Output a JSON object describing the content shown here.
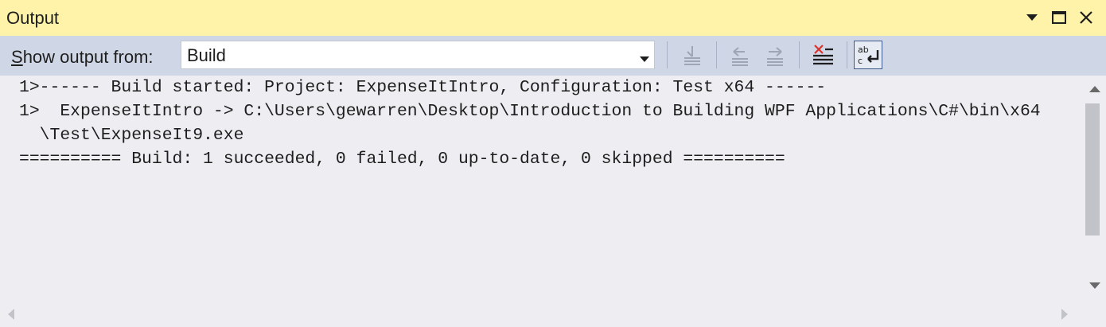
{
  "window": {
    "title": "Output",
    "controls": [
      "dropdown-icon",
      "maximize-icon",
      "close-icon"
    ]
  },
  "toolbar": {
    "show_label_prefix": "S",
    "show_label_rest": "how output from:",
    "source_value": "Build",
    "buttons": [
      "go-to-location-icon",
      "previous-message-icon",
      "next-message-icon",
      "clear-all-icon",
      "word-wrap-icon"
    ],
    "word_wrap_active": true
  },
  "output": {
    "lines": [
      "1>------ Build started: Project: ExpenseItIntro, Configuration: Test x64 ------",
      "1>  ExpenseItIntro -> C:\\Users\\gewarren\\Desktop\\Introduction to Building WPF Applications\\C#\\bin\\x64",
      "  \\Test\\ExpenseIt9.exe",
      "========== Build: 1 succeeded, 0 failed, 0 up-to-date, 0 skipped =========="
    ]
  },
  "colors": {
    "titlebar": "#fef3a8",
    "toolbar": "#cfd6e5",
    "output_bg": "#eeeef2",
    "clear_x": "#d9332b"
  }
}
